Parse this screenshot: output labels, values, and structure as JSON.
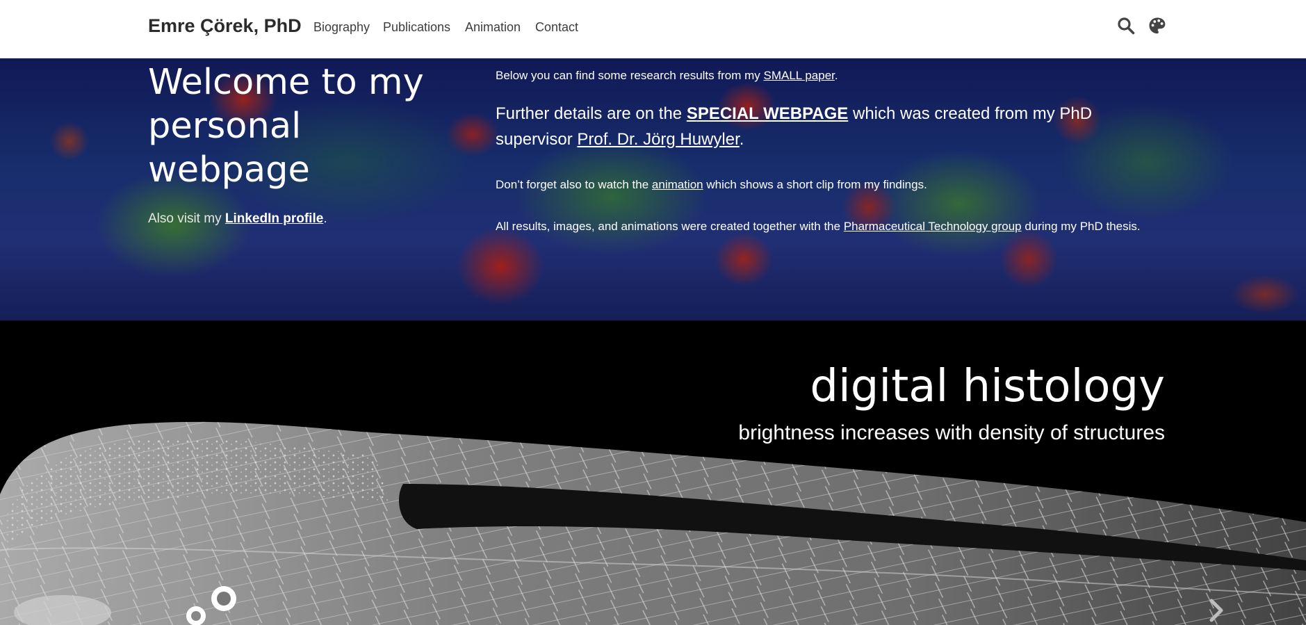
{
  "navbar": {
    "brand": "Emre Çörek, PhD",
    "links": [
      "Biography",
      "Publications",
      "Animation",
      "Contact"
    ],
    "icons": [
      "search-icon",
      "palette-icon"
    ]
  },
  "hero": {
    "title": "Welcome to my personal webpage",
    "sub_prefix": "Also visit my ",
    "linkedin_label": "LinkedIn profile",
    "sub_suffix": ".",
    "p1": {
      "prefix": "Below you can find some research results from my ",
      "link": "SMALL paper",
      "suffix": "."
    },
    "p2": {
      "prefix": "Further details are on the ",
      "link1": "SPECIAL WEBPAGE",
      "middle": " which was created from my PhD supervisor ",
      "link2": "Prof. Dr. Jörg Huwyler",
      "suffix": "."
    },
    "p3": {
      "prefix": "Don’t forget also to watch the ",
      "link": "animation",
      "suffix": " which shows a short clip from my findings."
    },
    "p4": {
      "prefix": "All results, images, and animations were created together with the ",
      "link": "Pharmaceutical Technology group",
      "suffix": " during my PhD thesis."
    }
  },
  "carousel": {
    "title": "digital histology",
    "subtitle": "brightness increases with density of structures",
    "next_icon": "chevron-right-icon"
  },
  "colors": {
    "navbar_bg": "#ffffff",
    "brand_text": "#2b2b2b",
    "hero_text": "#ffffff",
    "carousel_bg": "#000000"
  }
}
